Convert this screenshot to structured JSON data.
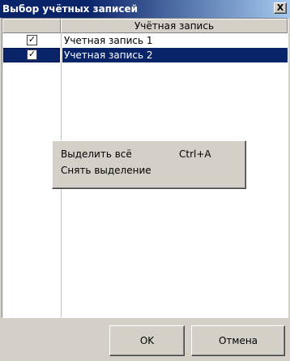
{
  "window": {
    "title": "Выбор учётных записей",
    "close_label": "X"
  },
  "list": {
    "columns": [
      "",
      "Учётная запись"
    ],
    "rows": [
      {
        "checked": true,
        "name": "Учетная запись 1",
        "selected": false
      },
      {
        "checked": true,
        "name": "Учетная запись 2",
        "selected": true
      }
    ]
  },
  "context_menu": {
    "items": [
      {
        "label": "Выделить всё",
        "shortcut": "Ctrl+A"
      },
      {
        "label": "Снять выделение",
        "shortcut": ""
      }
    ]
  },
  "buttons": {
    "ok_label": "OK",
    "cancel_label": "Отмена"
  },
  "icons": {
    "check": "checkmark-icon",
    "close": "close-icon"
  },
  "colors": {
    "title_bar": "#0a246a",
    "title_bar_end": "#a6caf0",
    "selection": "#0a246a",
    "face": "#d4d0c8"
  }
}
